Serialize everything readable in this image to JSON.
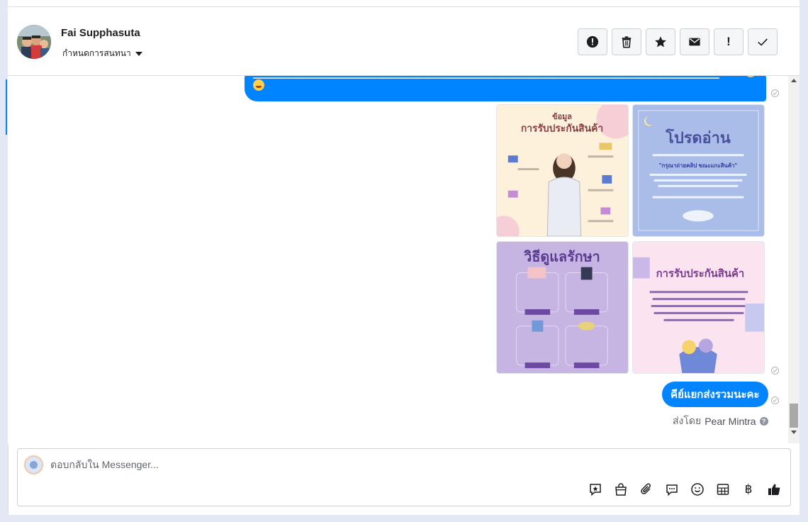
{
  "header": {
    "contact_name": "Fai Supphasuta",
    "assign_label": "กำหนดการสนทนา",
    "toolbar": [
      {
        "name": "report-spam-button",
        "icon": "alert-circle-icon"
      },
      {
        "name": "delete-button",
        "icon": "trash-icon"
      },
      {
        "name": "star-button",
        "icon": "star-icon"
      },
      {
        "name": "mark-unread-button",
        "icon": "envelope-icon"
      },
      {
        "name": "important-button",
        "icon": "exclamation-icon",
        "label": "!"
      },
      {
        "name": "done-button",
        "icon": "check-icon"
      }
    ]
  },
  "thread": {
    "top_bubble_emoji": "🥰",
    "images": [
      {
        "title": "ข้อมูล การรับประกันสินค้า",
        "bg": "#fdf1dc"
      },
      {
        "title": "โปรดอ่าน",
        "subtitle": "\"กรุณาถ่ายคลิป ขณะแกะสินค้า\"",
        "bg": "#a9bde8"
      },
      {
        "title": "วิธีดูแลรักษา",
        "bg": "#c6b5e2"
      },
      {
        "title": "การรับประกันสินค้า",
        "bg": "#fbe3ef"
      }
    ],
    "last_message": "คีย์แยกส่งรวมนะคะ",
    "sent_by_prefix": "ส่งโดย",
    "sent_by_name": "Pear Mintra",
    "help_glyph": "?"
  },
  "composer": {
    "placeholder": "ตอบกลับใน Messenger...",
    "tools": [
      "saved-reply-icon",
      "shop-bag-icon",
      "paperclip-icon",
      "chat-bubble-icon",
      "smiley-icon",
      "table-icon",
      "baht-icon",
      "like-icon"
    ],
    "baht_glyph": "฿"
  },
  "colors": {
    "accent": "#0084ff",
    "background": "#e4e8f5"
  }
}
